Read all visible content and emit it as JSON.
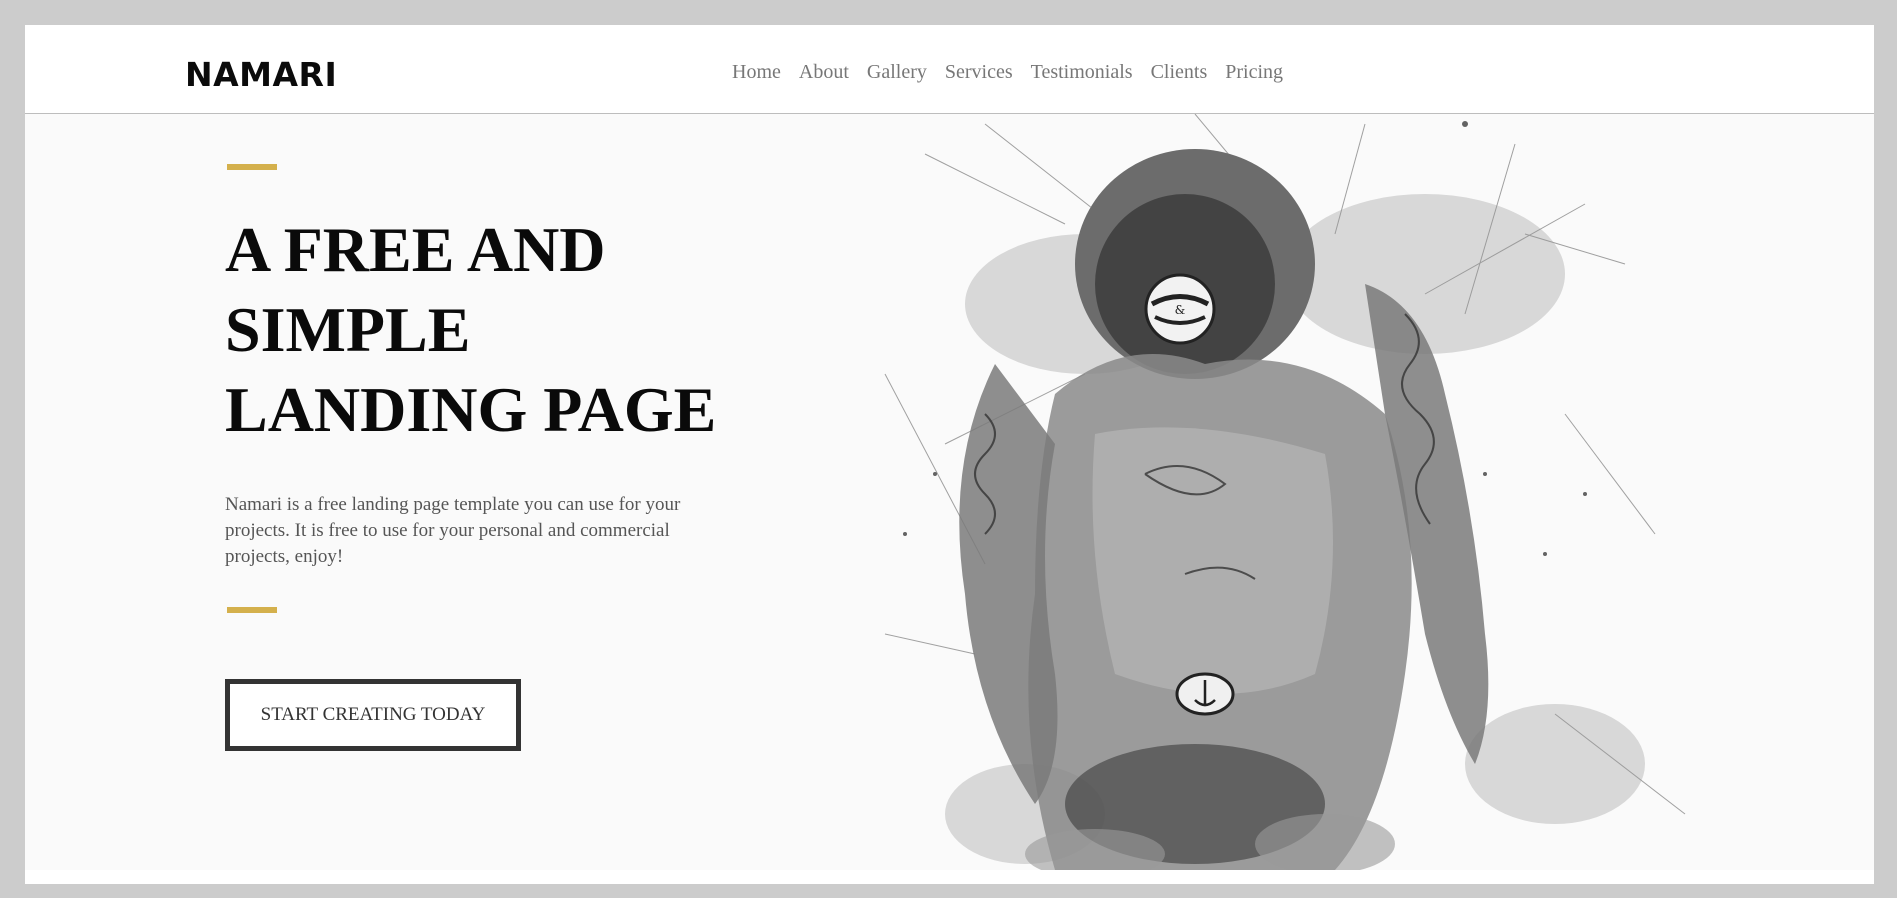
{
  "header": {
    "logo": "NAMARI",
    "nav": [
      "Home",
      "About",
      "Gallery",
      "Services",
      "Testimonials",
      "Clients",
      "Pricing"
    ]
  },
  "hero": {
    "headline": [
      "A FREE AND",
      "SIMPLE",
      "LANDING PAGE"
    ],
    "description": "Namari is a free landing page template you can use for your projects. It is free to use for your personal and commercial projects, enjoy!",
    "cta_label": "START CREATING TODAY",
    "illustration": "tattooed-figure-sketch-illustration"
  },
  "colors": {
    "accent": "#d4b04c",
    "text": "#0a0a0a",
    "muted": "#777777",
    "background": "#fafafa"
  }
}
